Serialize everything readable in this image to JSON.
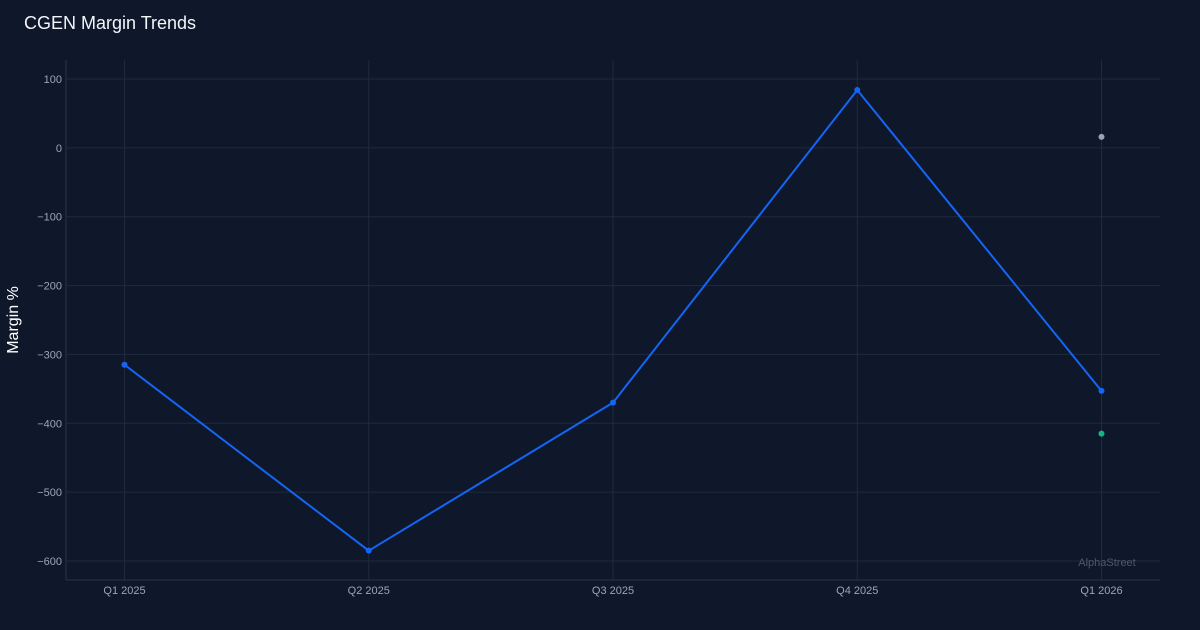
{
  "chart_data": {
    "type": "line",
    "title": "CGEN Margin Trends",
    "ylabel": "Margin %",
    "xlabel": "",
    "categories": [
      "Q1 2025",
      "Q2 2025",
      "Q3 2025",
      "Q4 2025",
      "Q1 2026"
    ],
    "ylim": [
      -627,
      127
    ],
    "yticks": [
      100,
      0,
      -100,
      -200,
      -300,
      -400,
      -500,
      -600
    ],
    "ytick_labels": [
      "100",
      "0",
      "−100",
      "−200",
      "−300",
      "−400",
      "−500",
      "−600"
    ],
    "grid": true,
    "series": [
      {
        "values": [
          -315,
          -585,
          -370,
          84,
          -353
        ],
        "color": "#1565f5"
      }
    ],
    "extra_points": [
      {
        "category": "Q1 2026",
        "value": 16,
        "color": "#9aa3b0"
      },
      {
        "category": "Q1 2026",
        "value": -415,
        "color": "#10b981"
      }
    ]
  },
  "watermark": "AlphaStreet",
  "colors": {
    "background": "#0e182a",
    "grid": "#1f2a3c",
    "tick_text": "#9aa6b8"
  }
}
